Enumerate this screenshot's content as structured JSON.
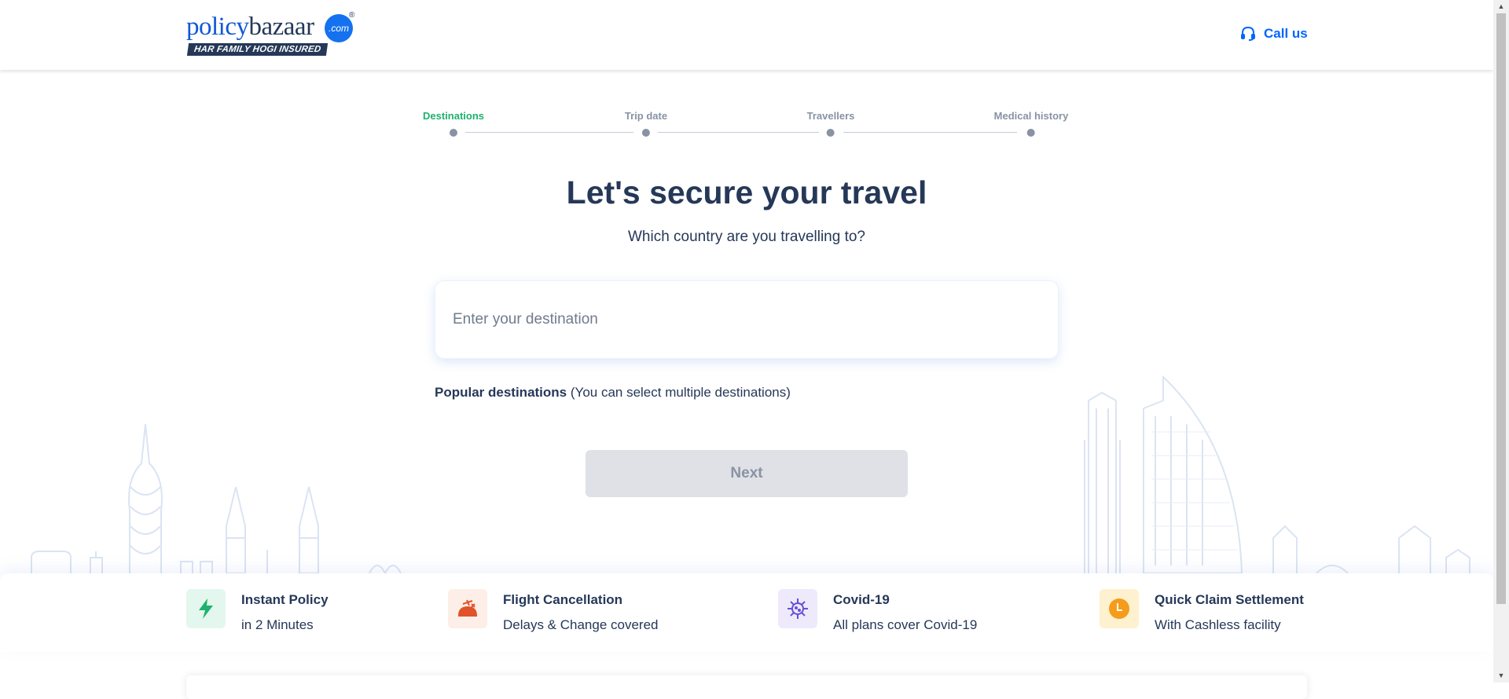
{
  "header": {
    "logo_primary": "policy",
    "logo_secondary": "bazaar",
    "logo_dot": ".com",
    "logo_reg": "®",
    "logo_tagline": "HAR FAMILY HOGI INSURED",
    "call_us_label": "Call us"
  },
  "stepper": {
    "steps": [
      {
        "label": "Destinations",
        "active": true
      },
      {
        "label": "Trip date",
        "active": false
      },
      {
        "label": "Travellers",
        "active": false
      },
      {
        "label": "Medical history",
        "active": false
      }
    ]
  },
  "main": {
    "title": "Let's secure your travel",
    "subtitle": "Which country are you travelling to?",
    "destination_placeholder": "Enter your destination",
    "destination_value": "",
    "popular_label": "Popular destinations",
    "popular_hint": "(You can select multiple destinations)",
    "next_label": "Next"
  },
  "features": [
    {
      "title": "Instant Policy",
      "subtitle": "in 2 Minutes",
      "icon": "lightning-icon",
      "icon_bg": "#e4f7ee",
      "icon_color": "#1eb26e"
    },
    {
      "title": "Flight Cancellation",
      "subtitle": "Delays & Change covered",
      "icon": "flight-cancel-icon",
      "icon_bg": "#fdeee8",
      "icon_color": "#e0522a"
    },
    {
      "title": "Covid-19",
      "subtitle": "All plans cover Covid-19",
      "icon": "virus-icon",
      "icon_bg": "#eeeafc",
      "icon_color": "#6a4fd6"
    },
    {
      "title": "Quick Claim Settlement",
      "subtitle": "With Cashless facility",
      "icon": "clock-icon",
      "icon_bg": "#fdf1cf",
      "icon_color": "#f59c1a"
    }
  ],
  "colors": {
    "brand_blue": "#0065ff",
    "active_step": "#1eb26e",
    "text_dark": "#253858",
    "disabled_button": "#dfe1e6"
  }
}
